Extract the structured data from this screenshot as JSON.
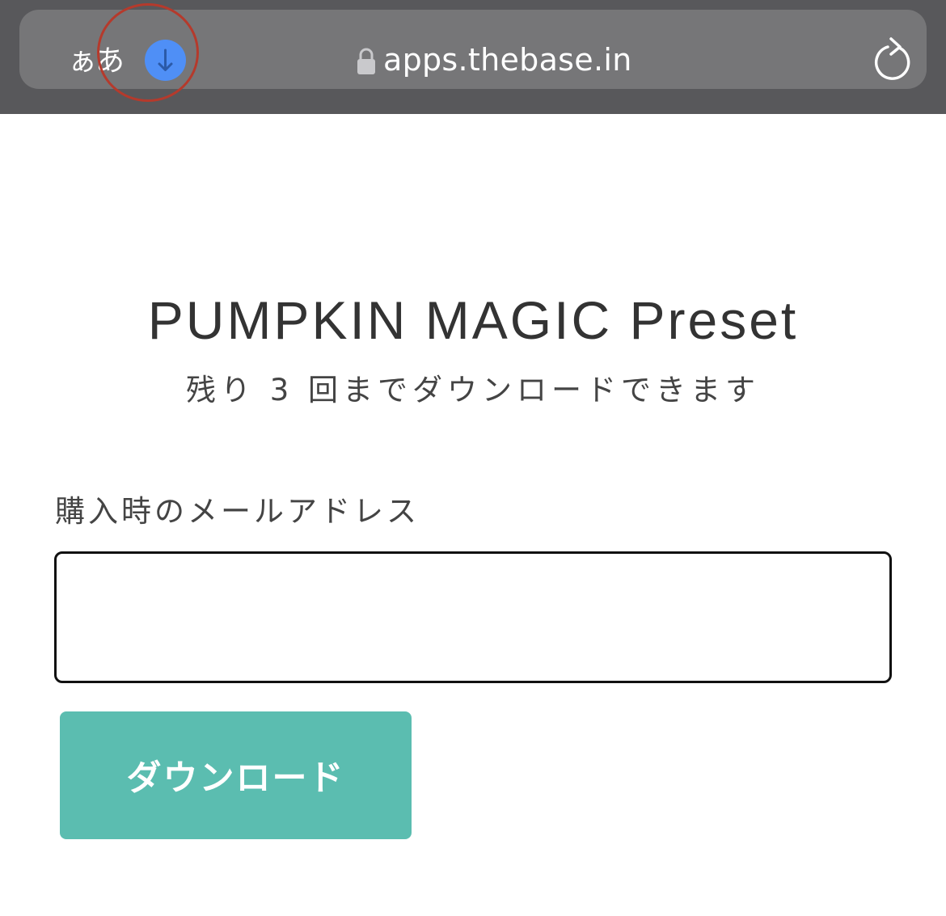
{
  "browser": {
    "text_size_label": "ぁあ",
    "download_icon": "arrow-down-circle-icon",
    "highlight_color": "#b53a2c",
    "lock_icon": "lock-icon",
    "url": "apps.thebase.in",
    "reload_icon": "reload-icon"
  },
  "page": {
    "title": "PUMPKIN MAGIC Preset",
    "remaining_text": "残り 3 回までダウンロードできます",
    "email_label": "購入時のメールアドレス",
    "email_value": "",
    "email_placeholder": "",
    "download_button_label": "ダウンロード",
    "button_color": "#5bbdb0"
  }
}
